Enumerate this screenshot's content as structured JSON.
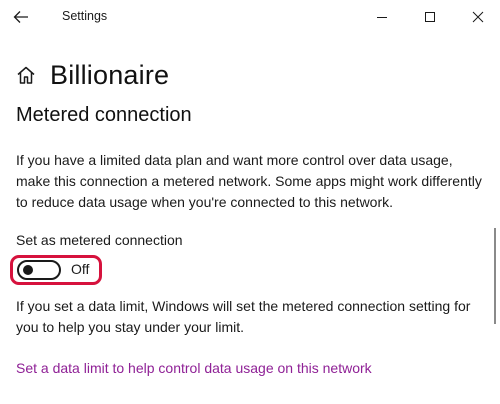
{
  "titlebar": {
    "title": "Settings",
    "back_icon": "back-arrow-icon",
    "minimize_icon": "minimize-icon",
    "maximize_icon": "maximize-icon",
    "close_icon": "close-icon"
  },
  "header": {
    "home_icon": "home-icon",
    "title": "Billionaire"
  },
  "section": {
    "title": "Metered connection",
    "description": "If you have a limited data plan and want more control over data usage, make this connection a metered network. Some apps might work differently to reduce data usage when you're connected to this network."
  },
  "metered_toggle": {
    "label": "Set as metered connection",
    "state_text": "Off",
    "is_on": false,
    "highlight_color": "#d6123d"
  },
  "limit_info": {
    "text": "If you set a data limit, Windows will set the metered connection setting for you to help you stay under your limit."
  },
  "link": {
    "text": "Set a data limit to help control data usage on this network",
    "color": "#8f2196"
  }
}
